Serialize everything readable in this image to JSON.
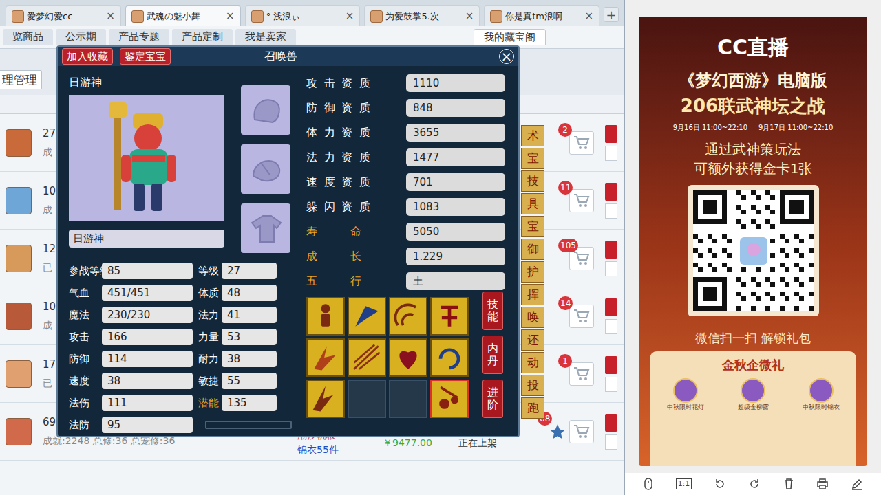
{
  "browser_tabs": [
    {
      "label": "爱梦幻爱cc",
      "selected": false
    },
    {
      "label": "武魂の魅小舞",
      "selected": true
    },
    {
      "label": "° 浅浪ぃ",
      "selected": false
    },
    {
      "label": "为爱鼓掌5.次",
      "selected": false
    },
    {
      "label": "你是真tm浪啊",
      "selected": false
    }
  ],
  "tab_close": "×",
  "new_tab": "+",
  "nav_tabs": [
    {
      "label": "览商品",
      "selected": false
    },
    {
      "label": "公示期",
      "selected": false
    },
    {
      "label": "产品专题",
      "selected": false
    },
    {
      "label": "产品定制",
      "selected": false
    },
    {
      "label": "我是卖家",
      "selected": false
    },
    {
      "label": "我的藏宝阁",
      "selected": true
    }
  ],
  "toolbar_button": "理管理",
  "rows": [
    {
      "level": "27",
      "sub": "成",
      "badge": "2",
      "color": "#c86a3a",
      "starred": false,
      "items": [],
      "price": "",
      "status": ""
    },
    {
      "level": "10",
      "sub": "成",
      "badge": "11",
      "color": "#6ea6d8",
      "starred": false,
      "items": [],
      "price": "",
      "status": ""
    },
    {
      "level": "12",
      "sub": "已",
      "badge": "105",
      "color": "#d89a5a",
      "starred": false,
      "items": [],
      "price": "",
      "status": ""
    },
    {
      "level": "10",
      "sub": "成",
      "badge": "14",
      "color": "#b85a3a",
      "starred": false,
      "items": [],
      "price": "",
      "status": ""
    },
    {
      "level": "17",
      "sub": "已",
      "badge": "1",
      "color": "#e0a070",
      "starred": false,
      "items": [],
      "price": "",
      "status": ""
    },
    {
      "level": "69",
      "sub": "成就:2248 总修:36 总宠修:36",
      "badge": "68",
      "color": "#d06a4a",
      "starred": true,
      "items": [
        "潮汐帆板",
        "锦衣55件"
      ],
      "price": "￥9477.00",
      "status": "正在上架"
    }
  ],
  "dialog": {
    "title": "召唤兽",
    "buttons": [
      "加入收藏",
      "鉴定宝宝"
    ],
    "close": "×",
    "pet_name": "日游神",
    "name_field": "日游神",
    "stats": [
      [
        {
          "label": "参战等级",
          "value": "85",
          "highlight": false
        },
        {
          "label": "等级",
          "value": "27",
          "highlight": false
        }
      ],
      [
        {
          "label": "气血",
          "value": "451/451",
          "highlight": false
        },
        {
          "label": "体质",
          "value": "48",
          "highlight": false
        }
      ],
      [
        {
          "label": "魔法",
          "value": "230/230",
          "highlight": false
        },
        {
          "label": "法力",
          "value": "41",
          "highlight": false
        }
      ],
      [
        {
          "label": "攻击",
          "value": "166",
          "highlight": false
        },
        {
          "label": "力量",
          "value": "53",
          "highlight": false
        }
      ],
      [
        {
          "label": "防御",
          "value": "114",
          "highlight": false
        },
        {
          "label": "耐力",
          "value": "38",
          "highlight": false
        }
      ],
      [
        {
          "label": "速度",
          "value": "38",
          "highlight": false
        },
        {
          "label": "敏捷",
          "value": "55",
          "highlight": false
        }
      ],
      [
        {
          "label": "法伤",
          "value": "111",
          "highlight": false
        },
        {
          "label": "潜能",
          "value": "135",
          "highlight": true
        }
      ],
      [
        {
          "label": "法防",
          "value": "95",
          "highlight": false
        }
      ]
    ],
    "qualities": [
      {
        "label": "攻击资质",
        "value": "1110",
        "highlight": false
      },
      {
        "label": "防御资质",
        "value": "848",
        "highlight": false
      },
      {
        "label": "体力资质",
        "value": "3655",
        "highlight": false
      },
      {
        "label": "法力资质",
        "value": "1477",
        "highlight": false
      },
      {
        "label": "速度资质",
        "value": "701",
        "highlight": false
      },
      {
        "label": "躲闪资质",
        "value": "1083",
        "highlight": false
      },
      {
        "label": "寿命",
        "value": "5050",
        "highlight": true
      },
      {
        "label": "成长",
        "value": "1.229",
        "highlight": true
      },
      {
        "label": "五行",
        "value": "土",
        "highlight": true
      }
    ],
    "skills": [
      {
        "kind": "skill",
        "selected": false
      },
      {
        "kind": "skill",
        "selected": false
      },
      {
        "kind": "skill",
        "selected": false
      },
      {
        "kind": "skill",
        "selected": false
      },
      {
        "kind": "skill",
        "selected": false
      },
      {
        "kind": "skill",
        "selected": false
      },
      {
        "kind": "skill",
        "selected": false
      },
      {
        "kind": "skill",
        "selected": false
      },
      {
        "kind": "skill",
        "selected": false
      },
      {
        "kind": "empty",
        "selected": false
      },
      {
        "kind": "empty",
        "selected": false
      },
      {
        "kind": "skill",
        "selected": true
      }
    ],
    "side_buttons": [
      "技能",
      "内丹",
      "进阶"
    ]
  },
  "side_strip": [
    "术",
    "宝",
    "技",
    "具",
    "宝",
    "御",
    "护",
    "挥",
    "唤",
    "还",
    "动",
    "投",
    "跑"
  ],
  "ad": {
    "logo": "CC直播",
    "title": "《梦幻西游》电脑版",
    "subtitle": "206联武神坛之战",
    "dates": [
      "9月16日 11:00~22:10",
      "9月17日 11:00~22:10"
    ],
    "lines": [
      "通过武神策玩法",
      "可额外获得金卡1张"
    ],
    "scan": "微信扫一扫 解锁礼包",
    "gift_title": "金秋企微礼",
    "gifts": [
      "中秋限时花灯",
      "超级金柳露",
      "中秋限时锦衣"
    ]
  },
  "viewer_toolbar": {
    "ratio": "1:1"
  }
}
